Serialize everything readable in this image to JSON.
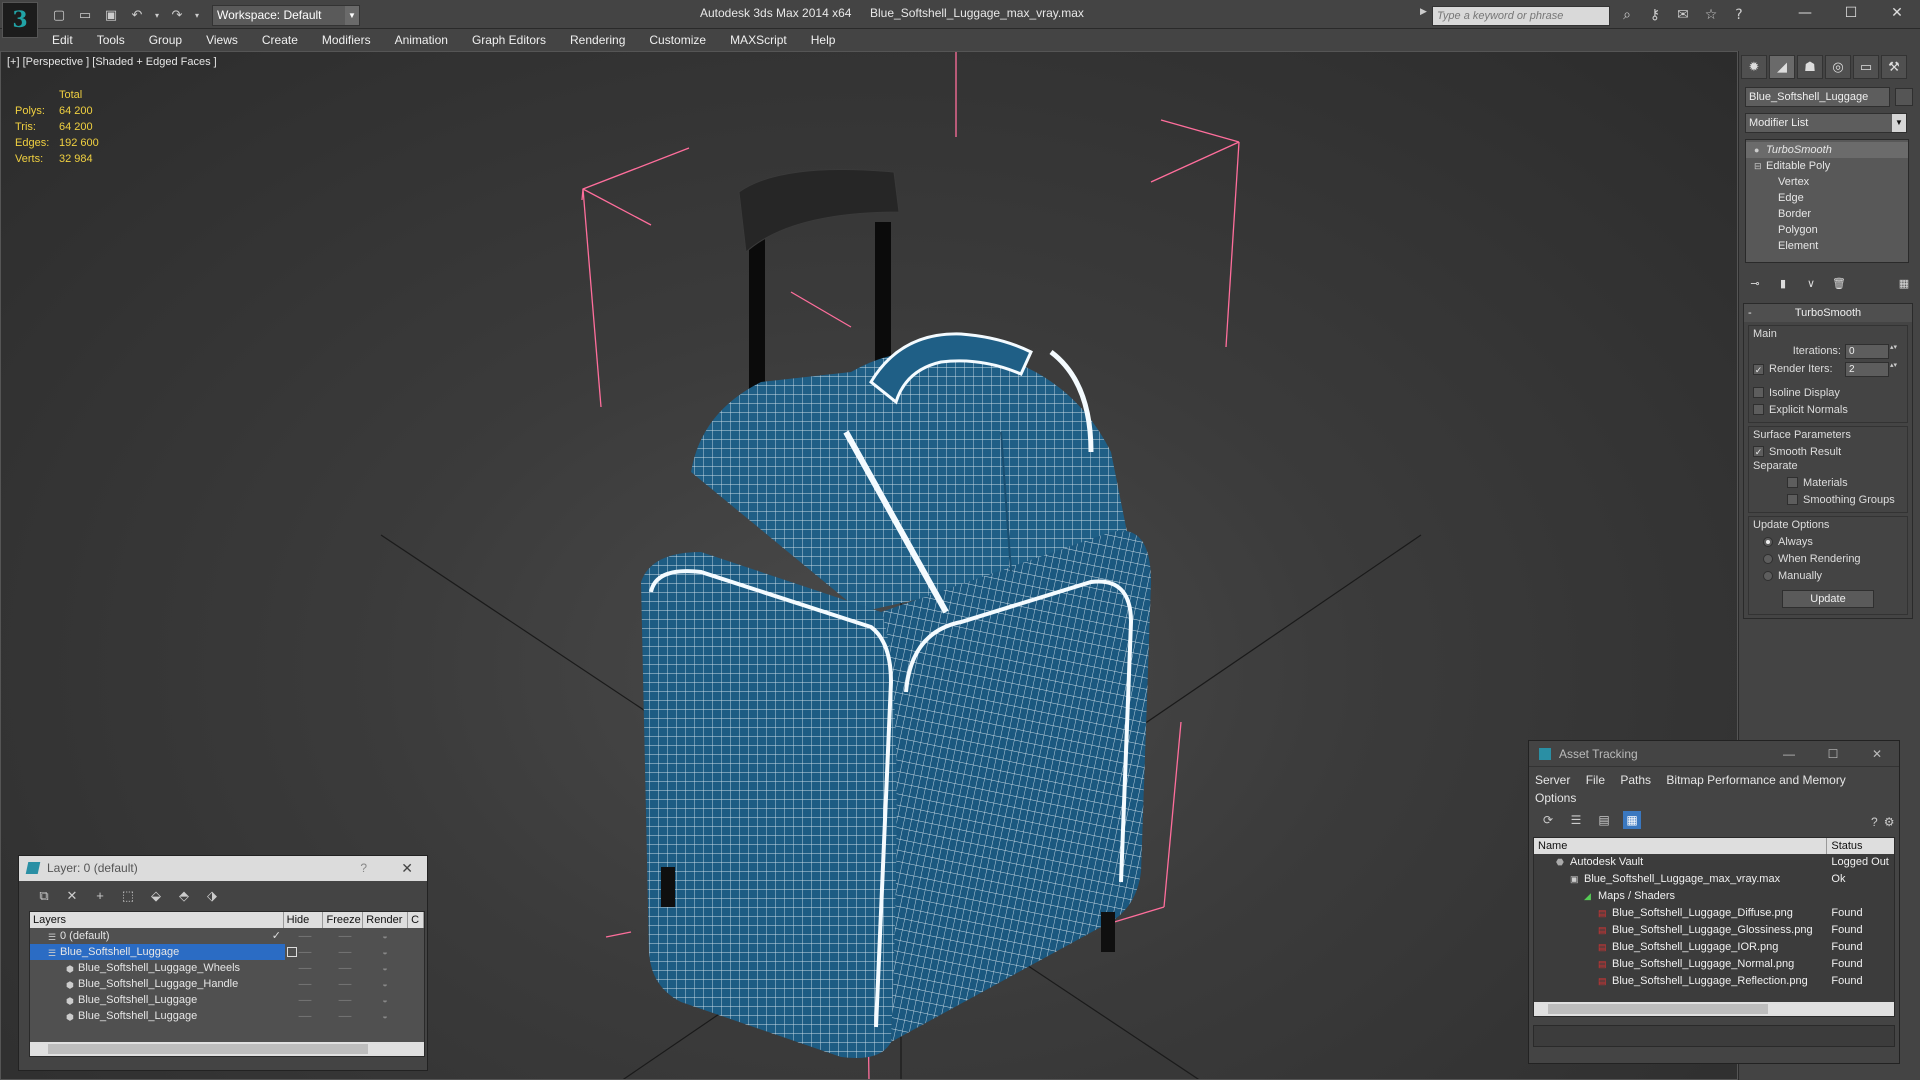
{
  "titlebar": {
    "app_title": "Autodesk 3ds Max  2014 x64",
    "file_title": "Blue_Softshell_Luggage_max_vray.max",
    "workspace_label": "Workspace: Default",
    "search_placeholder": "Type a keyword or phrase",
    "logo_glyph": "3"
  },
  "menu": {
    "items": [
      "Edit",
      "Tools",
      "Group",
      "Views",
      "Create",
      "Modifiers",
      "Animation",
      "Graph Editors",
      "Rendering",
      "Customize",
      "MAXScript",
      "Help"
    ]
  },
  "viewport": {
    "label": "[+] [Perspective ] [Shaded + Edged Faces ]",
    "stats": {
      "header": "Total",
      "rows": [
        {
          "label": "Polys:",
          "value": "64 200"
        },
        {
          "label": "Tris:",
          "value": "64 200"
        },
        {
          "label": "Edges:",
          "value": "192 600"
        },
        {
          "label": "Verts:",
          "value": "32 984"
        }
      ]
    },
    "colors": {
      "mesh": "#1e5f86",
      "wire": "#e8f2f8",
      "bbox": "#ff6e9c",
      "grid": "#1a1a1a"
    }
  },
  "command_panel": {
    "object_name": "Blue_Softshell_Luggage",
    "modifier_list": "Modifier List",
    "stack": {
      "top": "TurboSmooth",
      "base": "Editable Poly",
      "subs": [
        "Vertex",
        "Edge",
        "Border",
        "Polygon",
        "Element"
      ]
    },
    "turbosmooth": {
      "title": "TurboSmooth",
      "main_title": "Main",
      "iterations_label": "Iterations:",
      "iterations_value": "0",
      "render_iters_label": "Render Iters:",
      "render_iters_value": "2",
      "isoline_label": "Isoline Display",
      "explicit_label": "Explicit Normals",
      "surface_title": "Surface Parameters",
      "smooth_result_label": "Smooth Result",
      "separate_label": "Separate",
      "materials_label": "Materials",
      "smoothing_label": "Smoothing Groups",
      "update_title": "Update Options",
      "always_label": "Always",
      "when_rendering_label": "When Rendering",
      "manually_label": "Manually",
      "update_button": "Update"
    }
  },
  "layer_dialog": {
    "title": "Layer: 0 (default)",
    "help": "?",
    "columns": [
      "Layers",
      "Hide",
      "Freeze",
      "Render",
      "C"
    ],
    "rows": [
      {
        "name": "0 (default)",
        "child": false,
        "selected": false
      },
      {
        "name": "Blue_Softshell_Luggage",
        "child": false,
        "selected": true
      },
      {
        "name": "Blue_Softshell_Luggage_Wheels",
        "child": true,
        "selected": false
      },
      {
        "name": "Blue_Softshell_Luggage_Handle",
        "child": true,
        "selected": false
      },
      {
        "name": "Blue_Softshell_Luggage",
        "child": true,
        "selected": false
      },
      {
        "name": "Blue_Softshell_Luggage",
        "child": true,
        "selected": false
      }
    ]
  },
  "asset_dialog": {
    "title": "Asset Tracking",
    "menu": [
      "Server",
      "File",
      "Paths",
      "Bitmap Performance and Memory",
      "Options"
    ],
    "columns": {
      "name": "Name",
      "status": "Status"
    },
    "rows": [
      {
        "name": "Autodesk Vault",
        "status": "Logged Out",
        "indent": 1
      },
      {
        "name": "Blue_Softshell_Luggage_max_vray.max",
        "status": "Ok",
        "indent": 2
      },
      {
        "name": "Maps / Shaders",
        "status": "",
        "indent": 3
      },
      {
        "name": "Blue_Softshell_Luggage_Diffuse.png",
        "status": "Found",
        "indent": 4
      },
      {
        "name": "Blue_Softshell_Luggage_Glossiness.png",
        "status": "Found",
        "indent": 4
      },
      {
        "name": "Blue_Softshell_Luggage_IOR.png",
        "status": "Found",
        "indent": 4
      },
      {
        "name": "Blue_Softshell_Luggage_Normal.png",
        "status": "Found",
        "indent": 4
      },
      {
        "name": "Blue_Softshell_Luggage_Reflection.png",
        "status": "Found",
        "indent": 4
      }
    ]
  }
}
